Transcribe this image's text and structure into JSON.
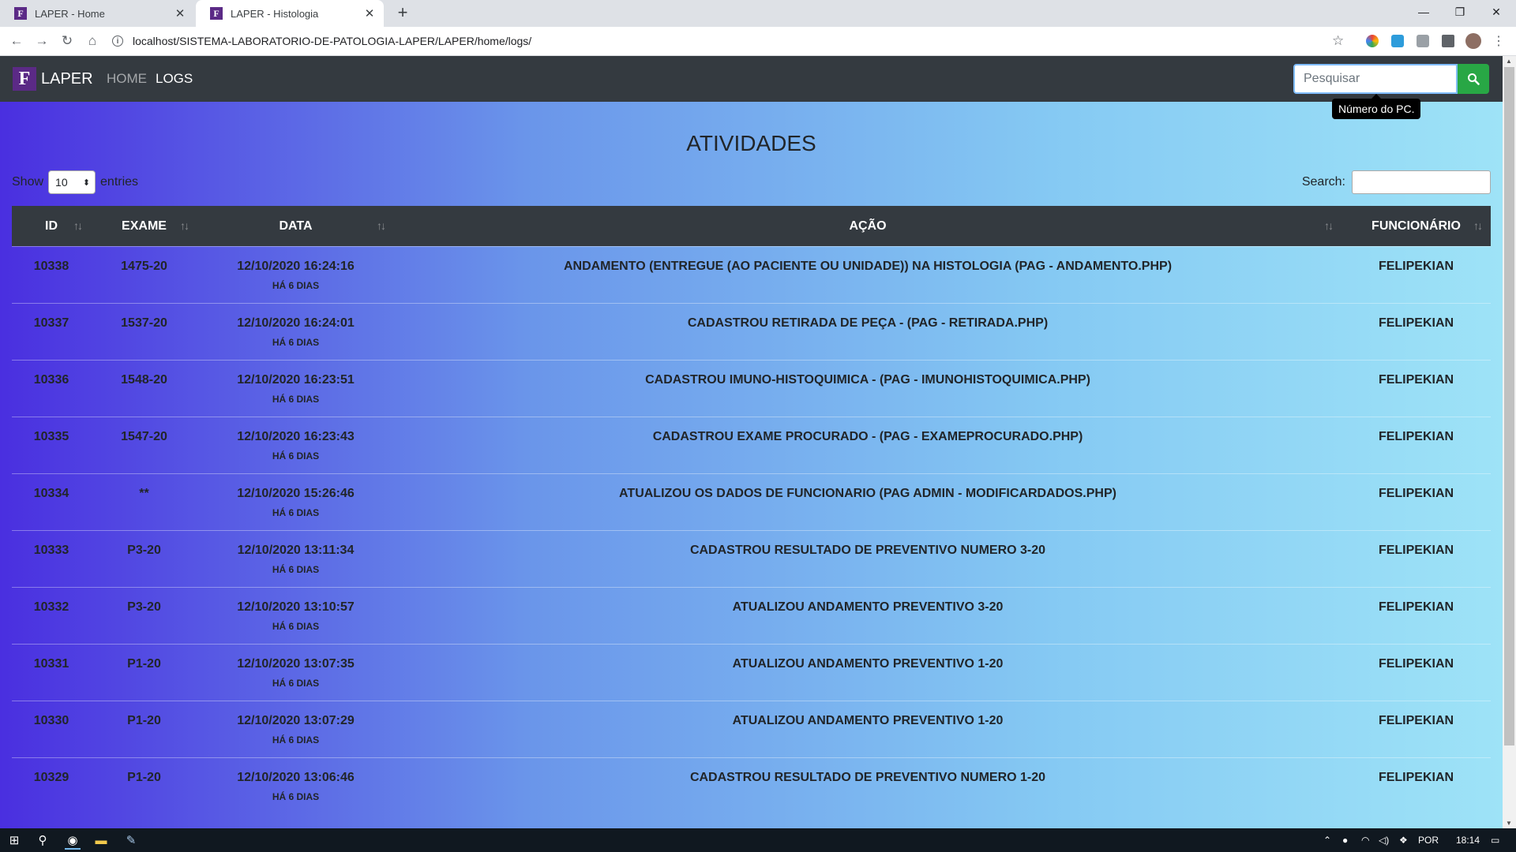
{
  "browser": {
    "tabs": [
      {
        "title": "LAPER - Home",
        "favicon": "F"
      },
      {
        "title": "LAPER - Histologia",
        "favicon": "F"
      }
    ],
    "url": "localhost/SISTEMA-LABORATORIO-DE-PATOLOGIA-LAPER/LAPER/home/logs/"
  },
  "navbar": {
    "brand": "LAPER",
    "brand_logo": "F",
    "links": [
      "HOME",
      "LOGS"
    ],
    "search_placeholder": "Pesquisar",
    "tooltip": "Número do PC.",
    "accent_color": "#28a745"
  },
  "page": {
    "title": "ATIVIDADES",
    "length_show": "Show",
    "length_value": "10",
    "length_entries": "entries",
    "search_label": "Search:"
  },
  "table": {
    "headers": [
      "ID",
      "EXAME",
      "DATA",
      "AÇÃO",
      "FUNCIONÁRIO"
    ],
    "rows": [
      {
        "id": "10338",
        "exame": "1475-20",
        "data": "12/10/2020 16:24:16",
        "ago": "HÁ 6 DIAS",
        "acao": "ANDAMENTO (ENTREGUE (AO PACIENTE OU UNIDADE)) NA HISTOLOGIA (PAG - ANDAMENTO.PHP)",
        "func": "FELIPEKIAN"
      },
      {
        "id": "10337",
        "exame": "1537-20",
        "data": "12/10/2020 16:24:01",
        "ago": "HÁ 6 DIAS",
        "acao": "CADASTROU RETIRADA DE PEÇA - (PAG - RETIRADA.PHP)",
        "func": "FELIPEKIAN"
      },
      {
        "id": "10336",
        "exame": "1548-20",
        "data": "12/10/2020 16:23:51",
        "ago": "HÁ 6 DIAS",
        "acao": "CADASTROU IMUNO-HISTOQUIMICA - (PAG - IMUNOHISTOQUIMICA.PHP)",
        "func": "FELIPEKIAN"
      },
      {
        "id": "10335",
        "exame": "1547-20",
        "data": "12/10/2020 16:23:43",
        "ago": "HÁ 6 DIAS",
        "acao": "CADASTROU EXAME PROCURADO - (PAG - EXAMEPROCURADO.PHP)",
        "func": "FELIPEKIAN"
      },
      {
        "id": "10334",
        "exame": "**",
        "data": "12/10/2020 15:26:46",
        "ago": "HÁ 6 DIAS",
        "acao": "ATUALIZOU OS DADOS DE FUNCIONARIO (PAG ADMIN - MODIFICARDADOS.PHP)",
        "func": "FELIPEKIAN"
      },
      {
        "id": "10333",
        "exame": "P3-20",
        "data": "12/10/2020 13:11:34",
        "ago": "HÁ 6 DIAS",
        "acao": "CADASTROU RESULTADO DE PREVENTIVO NUMERO 3-20",
        "func": "FELIPEKIAN"
      },
      {
        "id": "10332",
        "exame": "P3-20",
        "data": "12/10/2020 13:10:57",
        "ago": "HÁ 6 DIAS",
        "acao": "ATUALIZOU ANDAMENTO PREVENTIVO 3-20",
        "func": "FELIPEKIAN"
      },
      {
        "id": "10331",
        "exame": "P1-20",
        "data": "12/10/2020 13:07:35",
        "ago": "HÁ 6 DIAS",
        "acao": "ATUALIZOU ANDAMENTO PREVENTIVO 1-20",
        "func": "FELIPEKIAN"
      },
      {
        "id": "10330",
        "exame": "P1-20",
        "data": "12/10/2020 13:07:29",
        "ago": "HÁ 6 DIAS",
        "acao": "ATUALIZOU ANDAMENTO PREVENTIVO 1-20",
        "func": "FELIPEKIAN"
      },
      {
        "id": "10329",
        "exame": "P1-20",
        "data": "12/10/2020 13:06:46",
        "ago": "HÁ 6 DIAS",
        "acao": "CADASTROU RESULTADO DE PREVENTIVO NUMERO 1-20",
        "func": "FELIPEKIAN"
      }
    ]
  },
  "taskbar": {
    "language": "POR",
    "time": "18:14"
  }
}
